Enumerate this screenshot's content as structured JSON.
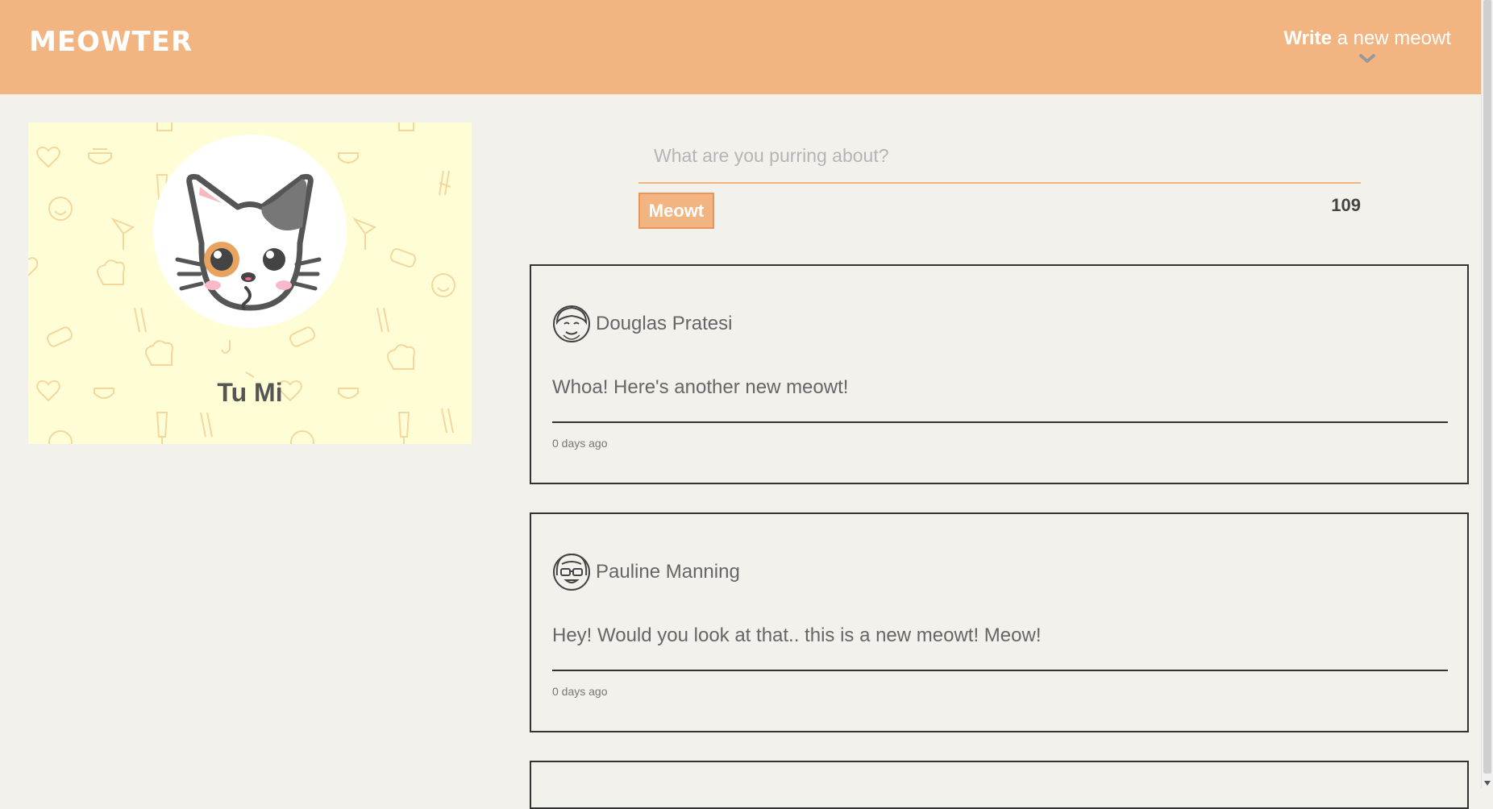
{
  "header": {
    "logo": "MEOWTER",
    "write_bold": "Write",
    "write_rest": " a new meowt"
  },
  "profile": {
    "name": "Tu Mi"
  },
  "composer": {
    "placeholder": "What are you purring about?",
    "value": "",
    "button_label": "Meowt",
    "char_count": "109"
  },
  "feed": [
    {
      "author": "Douglas Pratesi",
      "text": "Whoa! Here's another new meowt!",
      "time": "0 days ago"
    },
    {
      "author": "Pauline Manning",
      "text": "Hey! Would you look at that.. this is a new meowt! Meow!",
      "time": "0 days ago"
    }
  ],
  "colors": {
    "accent": "#f2b582",
    "profile_bg": "#fefdd6",
    "page_bg": "#f3f1ec"
  }
}
